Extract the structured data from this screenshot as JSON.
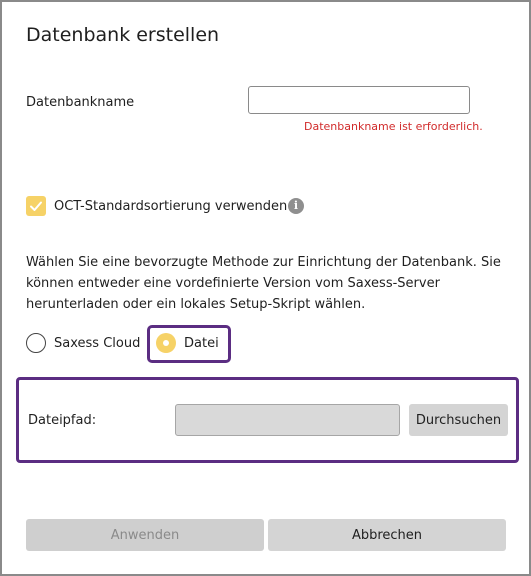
{
  "dialog": {
    "title": "Datenbank erstellen"
  },
  "db_name": {
    "label": "Datenbankname",
    "value": "",
    "error": "Datenbankname ist erforderlich."
  },
  "sorting": {
    "label": "OCT-Standardsortierung verwenden",
    "checked": true,
    "info_icon": "i"
  },
  "description": "Wählen Sie eine bevorzugte Methode zur Einrichtung der Datenbank. Sie können entweder eine vordefinierte Version vom Saxess-Server herunterladen oder ein lokales Setup-Skript wählen.",
  "method": {
    "options": [
      {
        "label": "Saxess Cloud",
        "selected": false
      },
      {
        "label": "Datei",
        "selected": true
      }
    ]
  },
  "file": {
    "label": "Dateipfad:",
    "value": "",
    "browse_label": "Durchsuchen"
  },
  "footer": {
    "apply_label": "Anwenden",
    "cancel_label": "Abbrechen"
  },
  "colors": {
    "accent": "#f6d267",
    "highlight": "#5b2d82",
    "error": "#d12b2b"
  }
}
